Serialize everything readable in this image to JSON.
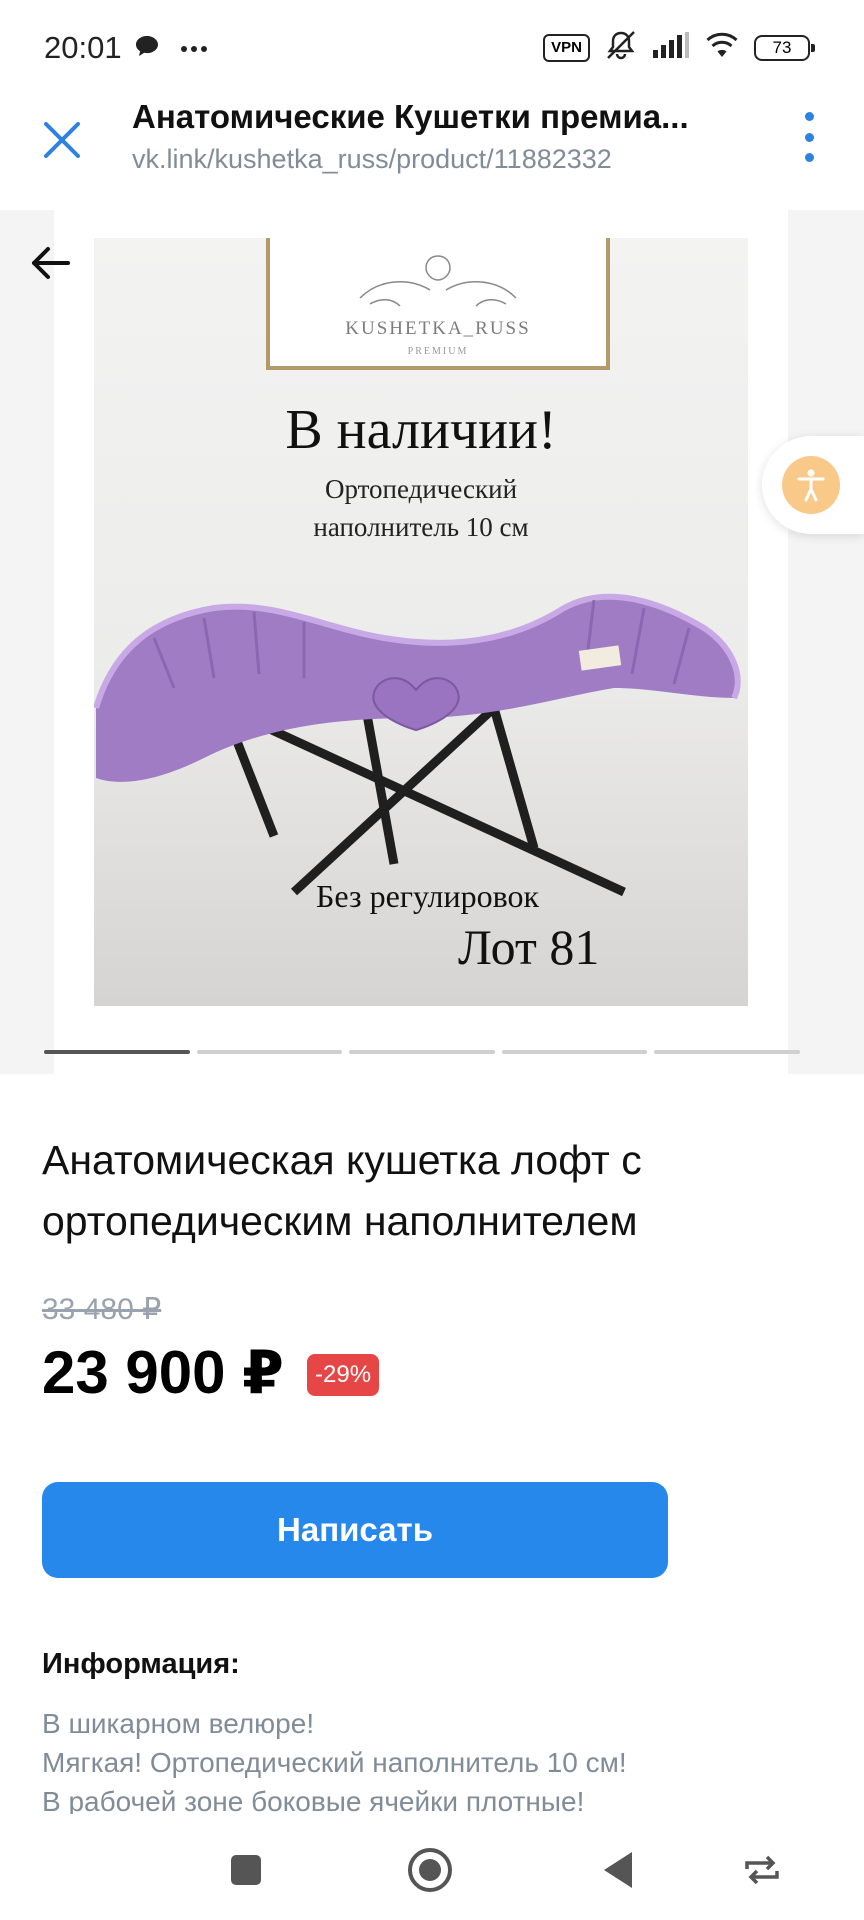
{
  "status_bar": {
    "time": "20:01",
    "vpn_label": "VPN",
    "battery_level": "73",
    "icons": [
      "chat-bubble-icon",
      "more-dots-icon",
      "vpn-icon",
      "mute-icon",
      "signal-icon",
      "wifi-icon",
      "battery-icon"
    ]
  },
  "browser": {
    "title": "Анатомические Кушетки премиа...",
    "url": "vk.link/kushetka_russ/product/11882332",
    "accent_color": "#2d81e0"
  },
  "gallery": {
    "image": {
      "logo_text": "KUSHETKA_RUSS",
      "logo_sub": "PREMIUM",
      "headline": "В наличии!",
      "sub_line1": "Ортопедический",
      "sub_line2": "наполнитель 10 см",
      "bottom_line1": "Без регулировок",
      "bottom_line2": "Лот 81"
    },
    "page_count": 5,
    "active_page": 1
  },
  "product": {
    "title": "Анатомическая кушетка лофт с ортопедическим наполнителем",
    "old_price": "33 480 ₽",
    "price": "23 900 ₽",
    "discount": "-29%",
    "write_button": "Написать",
    "info_heading": "Информация:",
    "info_lines": [
      "В шикарном велюре!",
      "Мягкая! Ортопедический наполнитель 10 см!",
      "В рабочей зоне боковые ячейки плотные!"
    ]
  },
  "colors": {
    "button_blue": "#2688eb",
    "discount_red": "#e64646",
    "secondary_text": "#818c99"
  }
}
